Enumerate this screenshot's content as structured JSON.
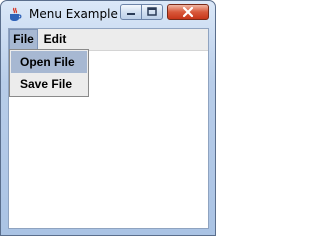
{
  "window": {
    "title": "Menu Example",
    "icon": "java-cup-icon"
  },
  "menubar": {
    "menus": [
      {
        "label": "File",
        "open": true
      },
      {
        "label": "Edit",
        "open": false
      }
    ]
  },
  "file_menu": {
    "items": [
      {
        "label": "Open File",
        "highlighted": true
      },
      {
        "label": "Save File",
        "highlighted": false
      }
    ]
  },
  "colors": {
    "selection": "#a7b8d2",
    "close_button": "#d8583b",
    "menu_background": "#ececec"
  }
}
